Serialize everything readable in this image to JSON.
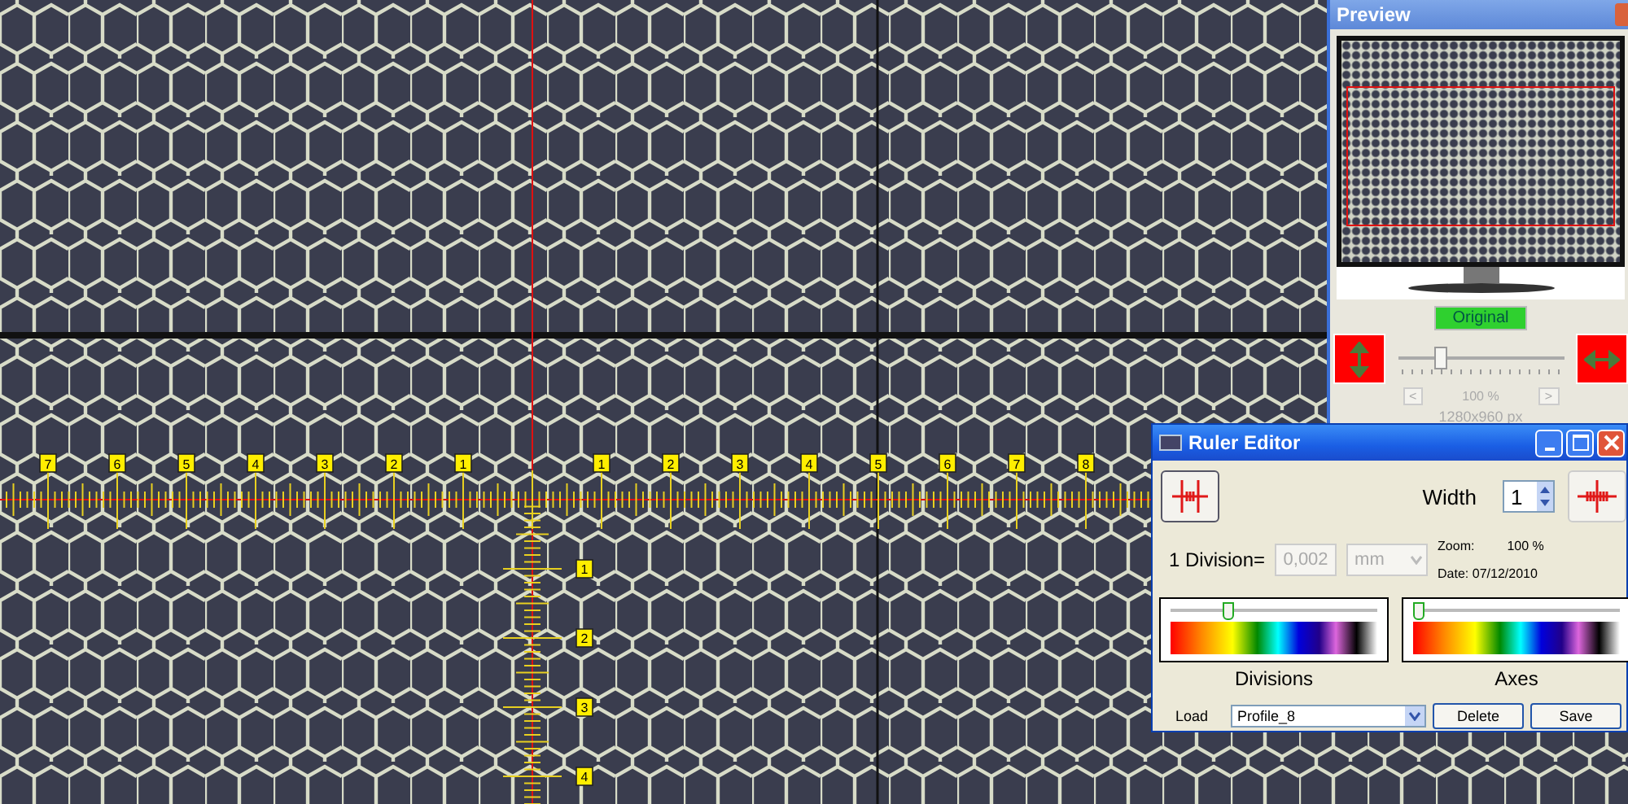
{
  "ruler_overlay": {
    "left_labels": [
      "7",
      "6",
      "5",
      "4",
      "3",
      "2",
      "1"
    ],
    "right_labels": [
      "1",
      "2",
      "3",
      "4",
      "5",
      "6",
      "7",
      "8"
    ],
    "down_labels": [
      "1",
      "2",
      "3",
      "4"
    ]
  },
  "preview": {
    "title": "Preview",
    "original_button": "Original",
    "zoom_slider": {
      "level": 0.25
    },
    "prev_button": "<",
    "zoom": "100 %",
    "next_button": ">",
    "resolution": "1280x960 px"
  },
  "ruler_editor": {
    "title": "Ruler Editor",
    "width_label": "Width",
    "width_value": "1",
    "division_label": "1 Division=",
    "division_field": {
      "value": "0,002",
      "disabled": true
    },
    "unit": "mm",
    "zoom_label": "Zoom:",
    "zoom_value": "100 %",
    "date": "Date: 07/12/2010",
    "divisions": {
      "label": "Divisions",
      "level": 0.25
    },
    "axes": {
      "label": "Axes",
      "level": 0
    },
    "load_label": "Load",
    "profile": "Profile_8",
    "delete_button": "Delete",
    "save_button": "Save"
  }
}
